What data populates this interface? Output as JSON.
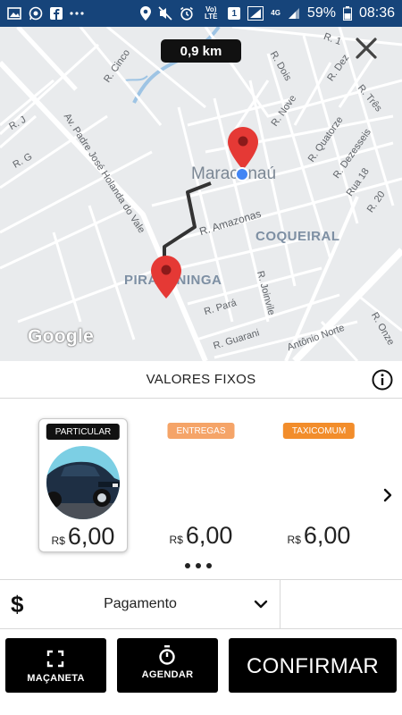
{
  "status_bar": {
    "battery_percent": "59%",
    "time": "08:36",
    "notification_count": "1",
    "network": "4G",
    "volte": "Vo) LTE",
    "left_icons": [
      "image-icon",
      "whatsapp-icon",
      "facebook-icon",
      "more-icon"
    ],
    "right_icons": [
      "location-icon",
      "mute-icon",
      "alarm-icon",
      "volte-icon",
      "notification-badge-icon",
      "signal-icon",
      "network-4g-icon",
      "signal-icon",
      "battery-icon"
    ]
  },
  "map": {
    "distance": "0,9 km",
    "close_icon": "close-icon",
    "attribution": "Google",
    "neighborhoods": [
      "COQUEIRAL",
      "PIRAPANINGA"
    ],
    "city": "Maracanaú",
    "streets": [
      "R. 1",
      "R. Cinco",
      "R. Dois",
      "R. Dez",
      "R. J",
      "R. G",
      "Av. Padre José Holanda do Vale",
      "R. Nove",
      "R. Três",
      "R. Quatorze",
      "R. Dezesseis",
      "Rua 18",
      "R. 20",
      "R. Amazonas",
      "R. Joinvile",
      "R. Pará",
      "R. Guarani",
      "Antônio Norte",
      "R. Onze"
    ],
    "colors": {
      "pin": "#e53935",
      "route": "#333333",
      "current_location": "#4285f4",
      "water": "#9ec4e4"
    }
  },
  "fixed_values": {
    "title": "VALORES FIXOS",
    "info_icon": "info-icon"
  },
  "options": [
    {
      "label": "PARTICULAR",
      "currency": "R$",
      "price": "6,00",
      "selected": true,
      "badge_color": "#111111"
    },
    {
      "label": "ENTREGAS",
      "currency": "R$",
      "price": "6,00",
      "selected": false,
      "badge_color": "#f5a468"
    },
    {
      "label": "TAXICOMUM",
      "currency": "R$",
      "price": "6,00",
      "selected": false,
      "badge_color": "#f28d2b"
    }
  ],
  "carousel": {
    "next_icon": "chevron-right-icon",
    "page_dots": 3
  },
  "payment": {
    "icon": "dollar-icon",
    "symbol": "$",
    "label": "Pagamento",
    "dropdown_icon": "chevron-down-icon"
  },
  "buttons": {
    "macaneta": "MAÇANETA",
    "agendar": "AGENDAR",
    "confirmar": "CONFIRMAR"
  }
}
